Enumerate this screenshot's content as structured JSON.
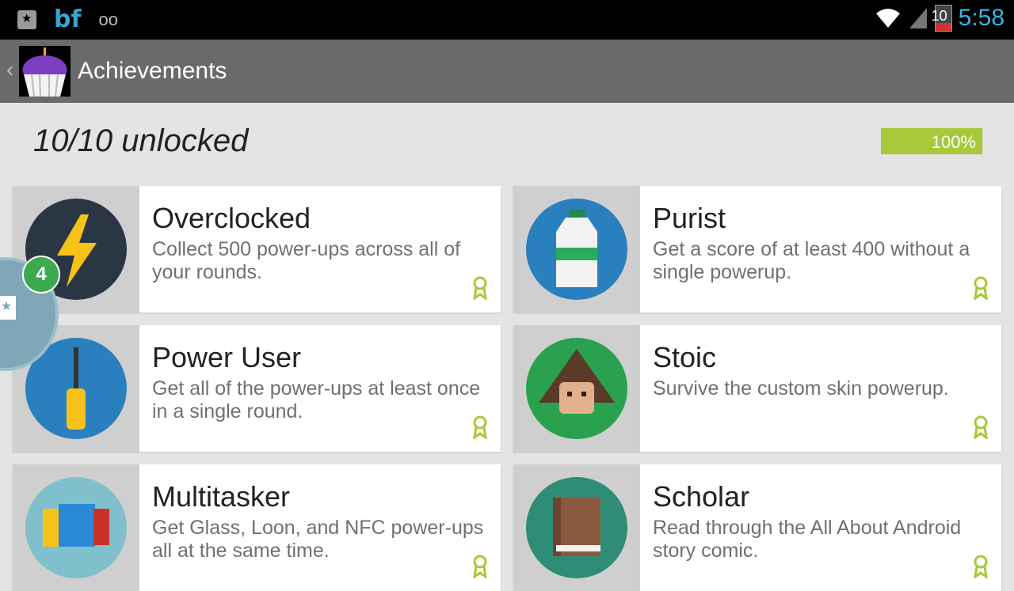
{
  "status": {
    "time": "5:58",
    "battery": "10",
    "notif_icons": [
      "star-notification-icon",
      "bf-app-icon",
      "voicemail-icon"
    ]
  },
  "actionbar": {
    "title": "Achievements",
    "back_icon": "chevron-left-icon"
  },
  "summary": {
    "unlocked_text": "10/10 unlocked",
    "progress_label": "100%",
    "progress_value": 1.0
  },
  "achievements": [
    {
      "name": "Overclocked",
      "description": "Collect 500 power-ups across all of your rounds.",
      "icon": "lightning-icon"
    },
    {
      "name": "Purist",
      "description": "Get a score of at least 400 without a single powerup.",
      "icon": "bottle-icon"
    },
    {
      "name": "Power User",
      "description": "Get all of the power-ups at least once in a single round.",
      "icon": "screwdriver-icon"
    },
    {
      "name": "Stoic",
      "description": "Survive the custom skin powerup.",
      "icon": "hooded-figure-icon"
    },
    {
      "name": "Multitasker",
      "description": "Get Glass, Loon, and NFC power-ups all at the same time.",
      "icon": "stacked-blocks-icon"
    },
    {
      "name": "Scholar",
      "description": "Read through the All About Android story comic.",
      "icon": "book-icon"
    }
  ],
  "chat_head": {
    "badge_count": "4"
  },
  "colors": {
    "accent_green": "#a7c93a",
    "clock_blue": "#33b5e5",
    "badge_green": "#3ba94d"
  }
}
